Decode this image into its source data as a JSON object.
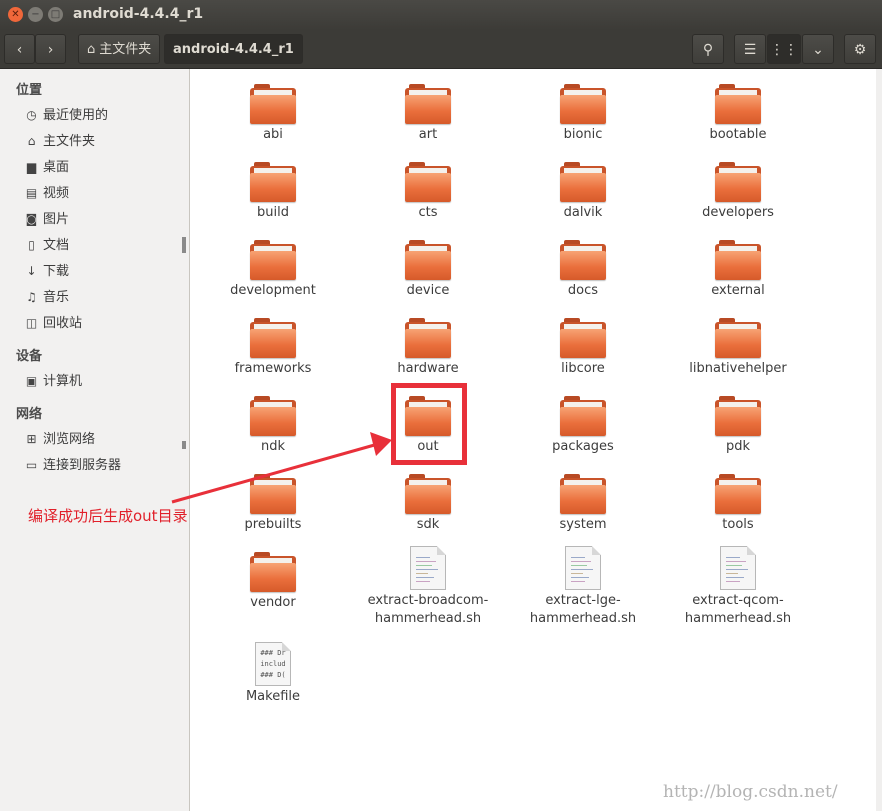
{
  "window": {
    "title": "android-4.4.4_r1"
  },
  "toolbar": {
    "home_label": "主文件夹",
    "current_path": "android-4.4.4_r1"
  },
  "sidebar": {
    "sections": [
      {
        "title": "位置",
        "items": [
          {
            "label": "最近使用的",
            "icon": "clock-icon"
          },
          {
            "label": "主文件夹",
            "icon": "home-icon"
          },
          {
            "label": "桌面",
            "icon": "desktop-icon"
          },
          {
            "label": "视频",
            "icon": "video-icon"
          },
          {
            "label": "图片",
            "icon": "camera-icon"
          },
          {
            "label": "文档",
            "icon": "document-icon"
          },
          {
            "label": "下载",
            "icon": "download-icon"
          },
          {
            "label": "音乐",
            "icon": "music-icon"
          },
          {
            "label": "回收站",
            "icon": "trash-icon"
          }
        ]
      },
      {
        "title": "设备",
        "items": [
          {
            "label": "计算机",
            "icon": "computer-icon"
          }
        ]
      },
      {
        "title": "网络",
        "items": [
          {
            "label": "浏览网络",
            "icon": "network-icon"
          },
          {
            "label": "连接到服务器",
            "icon": "server-icon"
          }
        ]
      }
    ]
  },
  "files": [
    {
      "name": "abi",
      "kind": "folder"
    },
    {
      "name": "art",
      "kind": "folder"
    },
    {
      "name": "bionic",
      "kind": "folder"
    },
    {
      "name": "bootable",
      "kind": "folder"
    },
    {
      "name": "build",
      "kind": "folder"
    },
    {
      "name": "cts",
      "kind": "folder"
    },
    {
      "name": "dalvik",
      "kind": "folder"
    },
    {
      "name": "developers",
      "kind": "folder"
    },
    {
      "name": "development",
      "kind": "folder"
    },
    {
      "name": "device",
      "kind": "folder"
    },
    {
      "name": "docs",
      "kind": "folder"
    },
    {
      "name": "external",
      "kind": "folder"
    },
    {
      "name": "frameworks",
      "kind": "folder"
    },
    {
      "name": "hardware",
      "kind": "folder"
    },
    {
      "name": "libcore",
      "kind": "folder"
    },
    {
      "name": "libnativehelper",
      "kind": "folder"
    },
    {
      "name": "ndk",
      "kind": "folder"
    },
    {
      "name": "out",
      "kind": "folder"
    },
    {
      "name": "packages",
      "kind": "folder"
    },
    {
      "name": "pdk",
      "kind": "folder"
    },
    {
      "name": "prebuilts",
      "kind": "folder"
    },
    {
      "name": "sdk",
      "kind": "folder"
    },
    {
      "name": "system",
      "kind": "folder"
    },
    {
      "name": "tools",
      "kind": "folder"
    },
    {
      "name": "vendor",
      "kind": "folder"
    },
    {
      "name": "extract-broadcom-hammerhead.sh",
      "line1": "extract-broadcom-",
      "line2": "hammerhead.sh",
      "kind": "script"
    },
    {
      "name": "extract-lge-hammerhead.sh",
      "line1": "extract-lge-",
      "line2": "hammerhead.sh",
      "kind": "script"
    },
    {
      "name": "extract-qcom-hammerhead.sh",
      "line1": "extract-qcom-",
      "line2": "hammerhead.sh",
      "kind": "script"
    },
    {
      "name": "Makefile",
      "kind": "text",
      "preview": [
        "### Dr",
        "includ",
        "### D("
      ]
    }
  ],
  "annotation": {
    "text": "编译成功后生成out目录",
    "highlighted_item": "out",
    "color": "#e8303a"
  },
  "watermark": "http://blog.csdn.net/"
}
